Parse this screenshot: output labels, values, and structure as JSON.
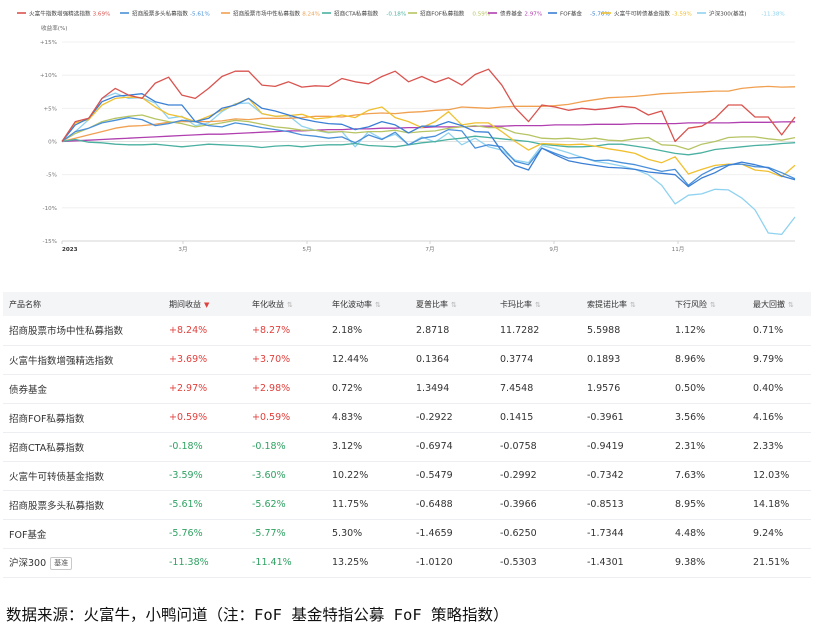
{
  "chart_data": {
    "type": "line",
    "ylabel": "收益率(%)",
    "x_ticks": [
      "2023",
      "3月",
      "5月",
      "7月",
      "9月",
      "11月"
    ],
    "y_ticks": [
      "+15%",
      "+10%",
      "+5%",
      "0%",
      "-5%",
      "-10%",
      "-15%"
    ],
    "ylim": [
      -15,
      15
    ],
    "grid": true,
    "legend_position": "top-left",
    "series": [
      {
        "name": "火富牛指数增强精选指数",
        "value_label": "3.69%",
        "color": "#d9534f",
        "values": [
          0,
          3,
          3.5,
          6.5,
          8,
          7,
          6.5,
          8.8,
          9.7,
          7,
          6.5,
          8,
          9.8,
          10.6,
          10.6,
          8.5,
          8.3,
          9,
          8.2,
          8.4,
          8.3,
          9.5,
          9,
          8.7,
          9.8,
          10.6,
          9,
          9.8,
          8.9,
          9.6,
          8.5,
          10.1,
          10.9,
          8.5,
          5.1,
          3,
          5.5,
          5.2,
          4.7,
          5,
          4.8,
          5,
          5.3,
          5.1,
          4,
          4.6,
          0,
          2,
          2.3,
          3.5,
          5.5,
          5.5,
          3.7,
          3.7,
          1,
          3.69
        ]
      },
      {
        "name": "招商股票多头私募指数",
        "value_label": "-5.61%",
        "color": "#4a90d9",
        "values": [
          0,
          1.5,
          2,
          2.8,
          3.2,
          3.6,
          3.3,
          2.4,
          2.7,
          3.2,
          3,
          2.4,
          2.2,
          2.8,
          2.5,
          2.1,
          1.8,
          1.5,
          1,
          0.8,
          0.5,
          0.7,
          -0.2,
          1,
          0.3,
          1.4,
          -0.5,
          0.5,
          0.8,
          1.8,
          1.6,
          -1,
          -0.5,
          -0.8,
          -3,
          -3.5,
          -1,
          -1.8,
          -2.5,
          -2.4,
          -2.9,
          -2.8,
          -3.2,
          -3.5,
          -4,
          -4.5,
          -4.2,
          -6.6,
          -5,
          -4,
          -3.5,
          -3.4,
          -3.8,
          -3.9,
          -4.7,
          -5.61
        ]
      },
      {
        "name": "招商股票市场中性私募指数",
        "value_label": "8.24%",
        "color": "#f0a050",
        "values": [
          0,
          0.5,
          1,
          1.5,
          2,
          2.3,
          2.4,
          2.6,
          2.9,
          3,
          3,
          3,
          3.1,
          3.4,
          3.3,
          3.5,
          3.5,
          3.5,
          3.6,
          3.8,
          3.8,
          3.7,
          4,
          4.2,
          4.3,
          4.2,
          4.4,
          4.5,
          4.7,
          4.8,
          5.2,
          5.1,
          5,
          5.2,
          5.3,
          5.3,
          5.3,
          5.4,
          5.6,
          6,
          6.3,
          6.6,
          6.7,
          6.8,
          7,
          7.2,
          7.3,
          7.4,
          7.5,
          7.6,
          7.6,
          8,
          8.2,
          8.3,
          8.2,
          8.24
        ]
      },
      {
        "name": "招商CTA私募指数",
        "value_label": "-0.18%",
        "color": "#4ab0a0",
        "values": [
          0,
          0.3,
          -0.1,
          -0.2,
          -0.4,
          -0.5,
          -0.5,
          -0.4,
          -0.6,
          -0.8,
          -0.6,
          -0.4,
          -0.5,
          -0.6,
          -0.7,
          -0.9,
          -0.7,
          -0.6,
          -0.8,
          -0.6,
          -0.5,
          -0.5,
          -0.3,
          -0.6,
          -0.7,
          -0.8,
          -0.5,
          -0.2,
          0,
          0.3,
          0.5,
          0.8,
          0.6,
          0.4,
          0.2,
          0,
          -0.4,
          -0.6,
          -0.8,
          -0.8,
          -0.7,
          -0.4,
          -0.4,
          -0.7,
          -1,
          -1.4,
          -1.8,
          -2,
          -1.7,
          -1.2,
          -1,
          -0.8,
          -0.6,
          -0.5,
          -0.3,
          -0.18
        ]
      },
      {
        "name": "招商FOF私募指数",
        "value_label": "0.59%",
        "color": "#b7c464",
        "values": [
          0,
          1.2,
          2,
          3,
          3.5,
          3.8,
          4,
          3.4,
          3,
          2.7,
          2.2,
          2.5,
          2.8,
          3.2,
          3,
          2.6,
          2.2,
          2,
          1.7,
          1.7,
          1.4,
          1.5,
          1.3,
          1.5,
          1.5,
          1.7,
          1.3,
          1.5,
          1.6,
          2,
          2.2,
          2.4,
          2.1,
          2.1,
          1.3,
          1,
          0.5,
          0.4,
          0.5,
          0.3,
          0.5,
          0.2,
          0.1,
          0.4,
          0.6,
          -0.5,
          -0.6,
          -1.2,
          -0.4,
          0,
          0.6,
          0.7,
          0.7,
          0.4,
          0.2,
          0.59
        ]
      },
      {
        "name": "债券基金",
        "value_label": "2.97%",
        "color": "#b040b0",
        "values": [
          0,
          0.1,
          0.2,
          0.3,
          0.4,
          0.5,
          0.6,
          0.7,
          0.8,
          0.9,
          1,
          1.1,
          1.1,
          1.2,
          1.3,
          1.4,
          1.5,
          1.6,
          1.6,
          1.7,
          1.8,
          1.8,
          1.9,
          1.9,
          2,
          2,
          2.1,
          2.1,
          2.2,
          2.2,
          2.2,
          2.3,
          2.3,
          2.3,
          2.4,
          2.4,
          2.4,
          2.5,
          2.5,
          2.5,
          2.6,
          2.6,
          2.6,
          2.7,
          2.7,
          2.7,
          2.7,
          2.8,
          2.8,
          2.8,
          2.8,
          2.9,
          2.9,
          2.9,
          2.95,
          2.97
        ]
      },
      {
        "name": "FOF基金",
        "value_label": "-5.76%",
        "color": "#3a7fd5",
        "values": [
          0,
          2.5,
          3.5,
          6,
          6.8,
          7,
          7.2,
          6,
          5.5,
          5.5,
          3,
          3.5,
          5,
          5.5,
          6.5,
          5,
          4.6,
          4,
          3.4,
          3,
          2.7,
          2.6,
          1.8,
          2.2,
          3,
          2.5,
          1.3,
          2.3,
          2.3,
          3,
          2.4,
          1.5,
          1.4,
          -1.5,
          -3.6,
          -4.3,
          -1,
          -2,
          -2.9,
          -3.3,
          -3.6,
          -3.9,
          -4,
          -4.2,
          -4.6,
          -4.8,
          -5,
          -6.8,
          -5.5,
          -4.7,
          -3.6,
          -3.1,
          -3.5,
          -4,
          -5.2,
          -5.76
        ]
      },
      {
        "name": "火富牛可转债基金指数",
        "value_label": "-3.59%",
        "color": "#f0c030",
        "values": [
          0,
          2.8,
          3.3,
          5.5,
          6.5,
          6.7,
          6.6,
          5.2,
          4.1,
          3.7,
          3,
          3.8,
          4.7,
          5.6,
          6.5,
          4.2,
          3.8,
          3.9,
          4.1,
          3.4,
          3.6,
          4,
          3.6,
          4.7,
          5.2,
          3.6,
          3,
          2.1,
          3,
          4.5,
          2.5,
          2.8,
          2.8,
          1.5,
          0,
          -1.3,
          -0.3,
          -0.4,
          -0.5,
          -0.4,
          -0.7,
          -1.1,
          -1.4,
          -1.8,
          -2.7,
          -3.2,
          -2.3,
          -4.9,
          -4.2,
          -3.6,
          -3.4,
          -3.4,
          -4.3,
          -4.5,
          -5.3,
          -3.59
        ]
      },
      {
        "name": "沪深300(基准)",
        "value_label": "-11.38%",
        "color": "#8fd2f0",
        "values": [
          0,
          1.5,
          3.3,
          6.5,
          7.3,
          6.5,
          6.6,
          5.8,
          3.5,
          3.8,
          2.4,
          2.8,
          4.5,
          5.7,
          5.8,
          4.2,
          3.8,
          3.9,
          2.3,
          1.7,
          1.3,
          1.5,
          -0.8,
          1.5,
          0.4,
          1.1,
          -0.5,
          0.7,
          -0.1,
          1.3,
          -0.5,
          0.5,
          -0.8,
          -1.3,
          -2.8,
          -3.2,
          -0.6,
          -1.1,
          -1.7,
          -2.4,
          -3,
          -3.3,
          -3.7,
          -4.2,
          -5,
          -6.6,
          -9.4,
          -8.1,
          -7.9,
          -7.2,
          -7.3,
          -8.5,
          -10.3,
          -13.8,
          -14,
          -11.38
        ]
      }
    ]
  },
  "table": {
    "headers": [
      "产品名称",
      "期间收益",
      "年化收益",
      "年化波动率",
      "夏普比率",
      "卡玛比率",
      "索提诺比率",
      "下行风险",
      "最大回撤"
    ],
    "benchmark_tag": "基准",
    "rows": [
      {
        "name": "招商股票市场中性私募指数",
        "period_return": "+8.24%",
        "annual_return": "+8.27%",
        "volatility": "2.18%",
        "sharpe": "2.8718",
        "calmar": "11.7282",
        "sortino": "5.5988",
        "downside_risk": "1.12%",
        "max_drawdown": "0.71%",
        "sign": "pos",
        "bench": false
      },
      {
        "name": "火富牛指数增强精选指数",
        "period_return": "+3.69%",
        "annual_return": "+3.70%",
        "volatility": "12.44%",
        "sharpe": "0.1364",
        "calmar": "0.3774",
        "sortino": "0.1893",
        "downside_risk": "8.96%",
        "max_drawdown": "9.79%",
        "sign": "pos",
        "bench": false
      },
      {
        "name": "债券基金",
        "period_return": "+2.97%",
        "annual_return": "+2.98%",
        "volatility": "0.72%",
        "sharpe": "1.3494",
        "calmar": "7.4548",
        "sortino": "1.9576",
        "downside_risk": "0.50%",
        "max_drawdown": "0.40%",
        "sign": "pos",
        "bench": false
      },
      {
        "name": "招商FOF私募指数",
        "period_return": "+0.59%",
        "annual_return": "+0.59%",
        "volatility": "4.83%",
        "sharpe": "-0.2922",
        "calmar": "0.1415",
        "sortino": "-0.3961",
        "downside_risk": "3.56%",
        "max_drawdown": "4.16%",
        "sign": "pos",
        "bench": false
      },
      {
        "name": "招商CTA私募指数",
        "period_return": "-0.18%",
        "annual_return": "-0.18%",
        "volatility": "3.12%",
        "sharpe": "-0.6974",
        "calmar": "-0.0758",
        "sortino": "-0.9419",
        "downside_risk": "2.31%",
        "max_drawdown": "2.33%",
        "sign": "neg",
        "bench": false
      },
      {
        "name": "火富牛可转债基金指数",
        "period_return": "-3.59%",
        "annual_return": "-3.60%",
        "volatility": "10.22%",
        "sharpe": "-0.5479",
        "calmar": "-0.2992",
        "sortino": "-0.7342",
        "downside_risk": "7.63%",
        "max_drawdown": "12.03%",
        "sign": "neg",
        "bench": false
      },
      {
        "name": "招商股票多头私募指数",
        "period_return": "-5.61%",
        "annual_return": "-5.62%",
        "volatility": "11.75%",
        "sharpe": "-0.6488",
        "calmar": "-0.3966",
        "sortino": "-0.8513",
        "downside_risk": "8.95%",
        "max_drawdown": "14.18%",
        "sign": "neg",
        "bench": false
      },
      {
        "name": "FOF基金",
        "period_return": "-5.76%",
        "annual_return": "-5.77%",
        "volatility": "5.30%",
        "sharpe": "-1.4659",
        "calmar": "-0.6250",
        "sortino": "-1.7344",
        "downside_risk": "4.48%",
        "max_drawdown": "9.24%",
        "sign": "neg",
        "bench": false
      },
      {
        "name": "沪深300",
        "period_return": "-11.38%",
        "annual_return": "-11.41%",
        "volatility": "13.25%",
        "sharpe": "-1.0120",
        "calmar": "-0.5303",
        "sortino": "-1.4301",
        "downside_risk": "9.38%",
        "max_drawdown": "21.51%",
        "sign": "neg",
        "bench": true
      }
    ]
  },
  "footer": {
    "source": "数据来源：火富牛，小鸭问道（注：FoF 基金特指公募 FoF 策略指数）"
  },
  "colors": {
    "positive": "#e0413d",
    "negative": "#2fa262"
  }
}
